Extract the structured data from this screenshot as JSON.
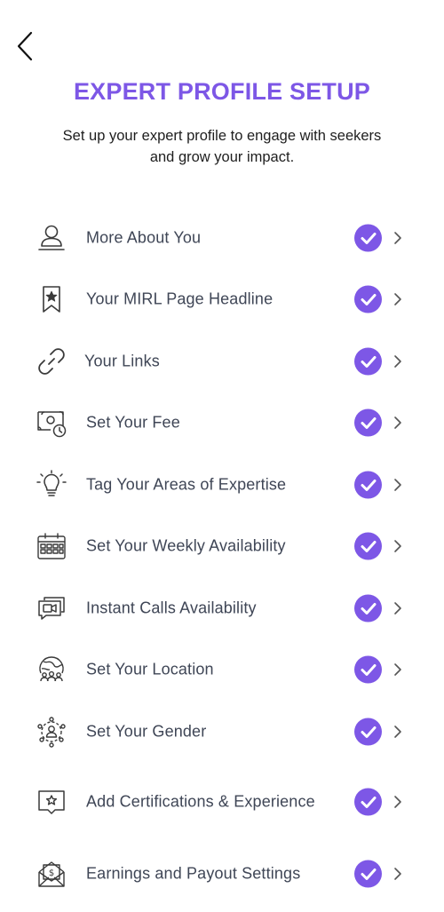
{
  "header": {
    "title": "EXPERT PROFILE SETUP",
    "subtitle": "Set up your expert profile to engage with seekers and grow your impact."
  },
  "colors": {
    "accent": "#7d57e6",
    "label": "#3f4656",
    "icon": "#3a3a3a"
  },
  "items": [
    {
      "label": "More About You",
      "icon": "user-icon",
      "completed": true
    },
    {
      "label": "Your MIRL Page Headline",
      "icon": "bookmark-star-icon",
      "completed": true
    },
    {
      "label": "Your Links",
      "icon": "link-icon",
      "completed": true
    },
    {
      "label": "Set Your Fee",
      "icon": "money-clock-icon",
      "completed": true
    },
    {
      "label": "Tag Your Areas of Expertise",
      "icon": "lightbulb-icon",
      "completed": true
    },
    {
      "label": "Set Your Weekly Availability",
      "icon": "calendar-icon",
      "completed": true
    },
    {
      "label": "Instant Calls Availability",
      "icon": "video-chat-icon",
      "completed": true
    },
    {
      "label": "Set Your Location",
      "icon": "globe-people-icon",
      "completed": true
    },
    {
      "label": "Set Your Gender",
      "icon": "gender-icon",
      "completed": true
    },
    {
      "label": "Add Certifications & Experience",
      "icon": "certificate-icon",
      "completed": true
    },
    {
      "label": "Earnings and Payout Settings",
      "icon": "payout-icon",
      "completed": true
    }
  ]
}
